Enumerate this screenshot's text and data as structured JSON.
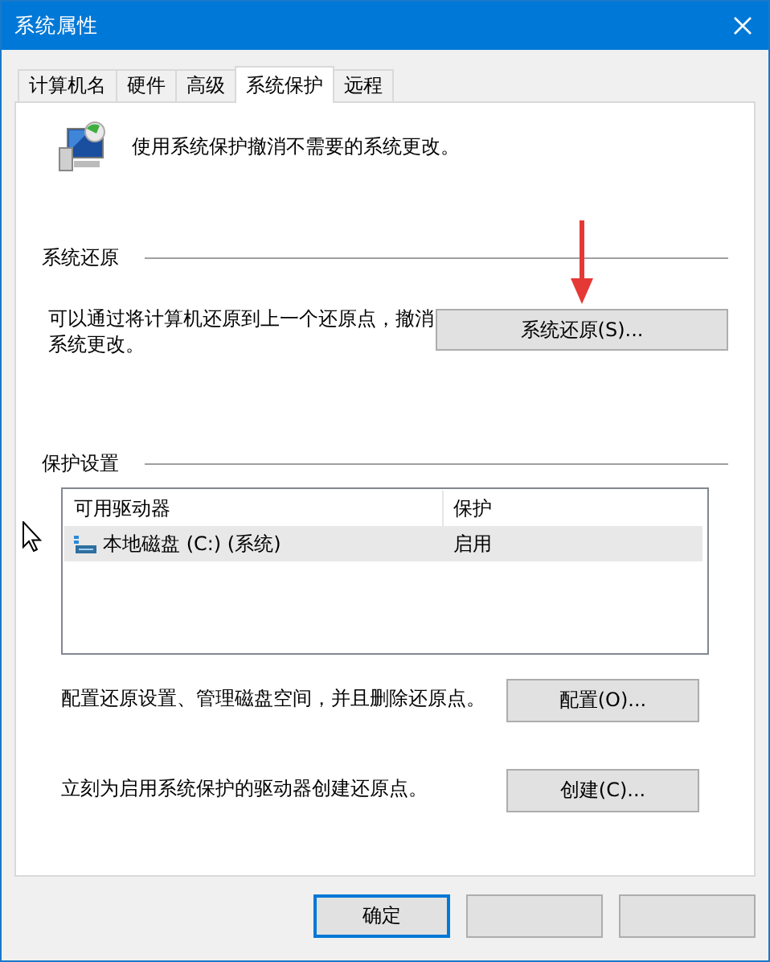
{
  "window": {
    "title": "系统属性"
  },
  "tabs": [
    {
      "label": "计算机名",
      "selected": false
    },
    {
      "label": "硬件",
      "selected": false
    },
    {
      "label": "高级",
      "selected": false
    },
    {
      "label": "系统保护",
      "selected": true
    },
    {
      "label": "远程",
      "selected": false
    }
  ],
  "intro": "使用系统保护撤消不需要的系统更改。",
  "restore_section": {
    "heading": "系统还原",
    "description": "可以通过将计算机还原到上一个还原点，撤消系统更改。",
    "button": "系统还原(S)..."
  },
  "protection_section": {
    "heading": "保护设置",
    "table": {
      "columns": [
        "可用驱动器",
        "保护"
      ],
      "rows": [
        {
          "drive": "本地磁盘 (C:) (系统)",
          "protection": "启用",
          "selected": true
        }
      ]
    },
    "actions": [
      {
        "description": "配置还原设置、管理磁盘空间，并且删除还原点。",
        "button": "配置(O)..."
      },
      {
        "description": "立刻为启用系统保护的驱动器创建还原点。",
        "button": "创建(C)..."
      }
    ]
  },
  "bottom_buttons": [
    {
      "label": "确定",
      "default": true
    },
    {
      "default": false
    },
    {
      "default": false
    }
  ]
}
